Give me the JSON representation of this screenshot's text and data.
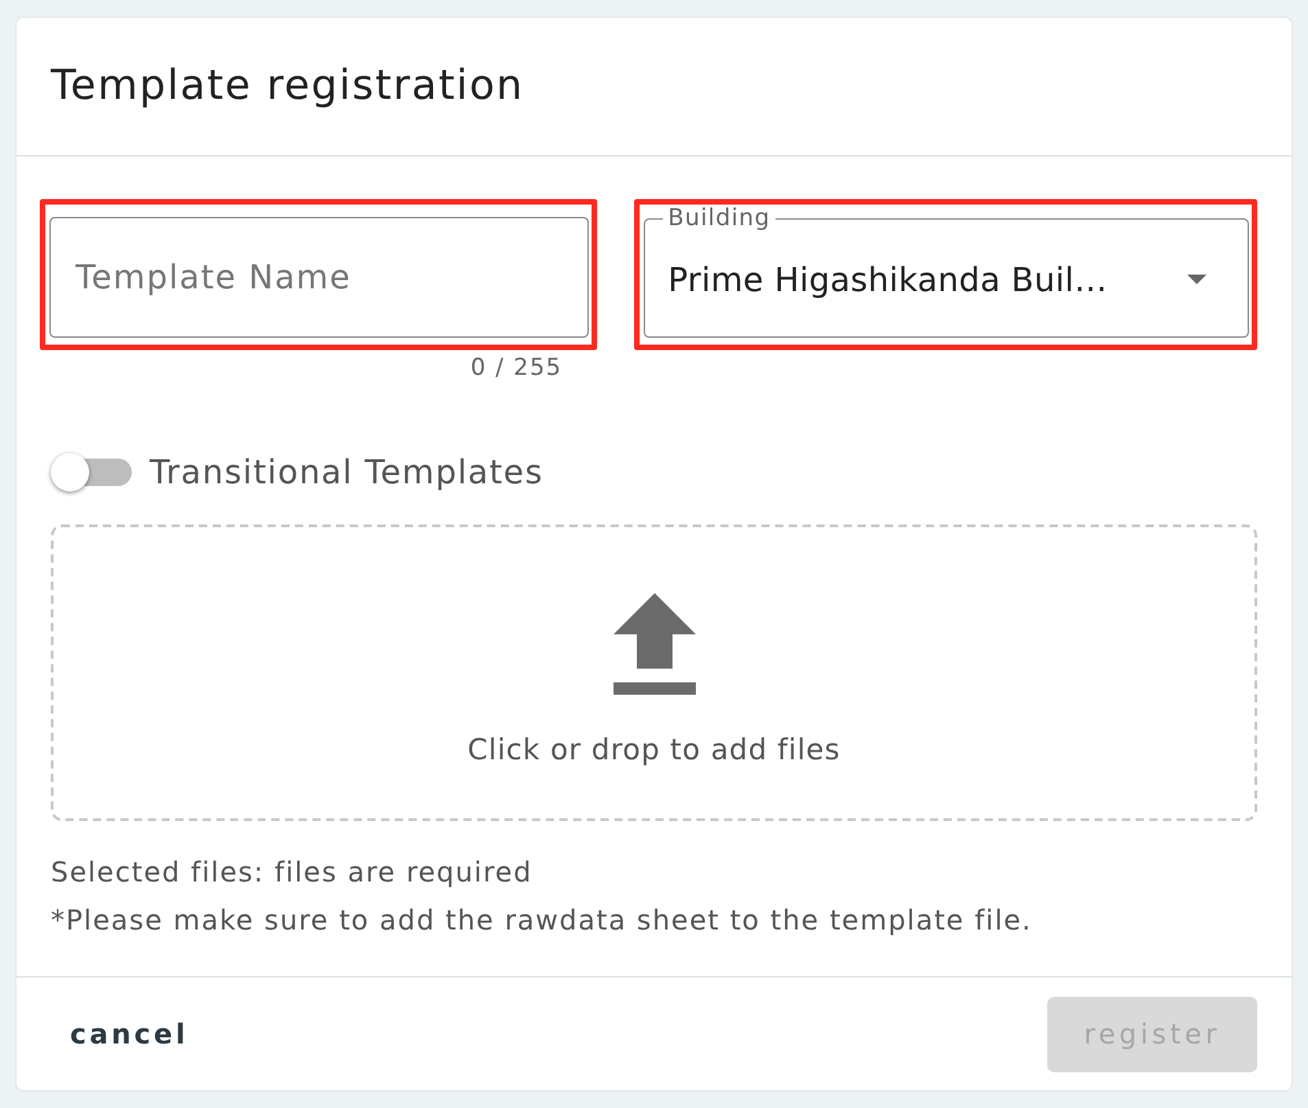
{
  "dialog": {
    "title": "Template registration"
  },
  "fields": [
    {
      "kind": "text",
      "placeholder": "Template Name",
      "counter": "0 / 255",
      "highlighted": true
    },
    {
      "kind": "select",
      "label": "Building",
      "value": "Prime Higashikanda Buil…",
      "highlighted": true
    }
  ],
  "toggle": {
    "label": "Transitional Templates",
    "on": false
  },
  "dropzone": {
    "text": "Click or drop to add files"
  },
  "notes": [
    "Selected files: files are required",
    "*Please make sure to add the rawdata sheet to the template file."
  ],
  "buttons": [
    {
      "kind": "cancel",
      "label": "cancel",
      "disabled": false
    },
    {
      "kind": "submit",
      "label": "register",
      "disabled": true
    }
  ]
}
